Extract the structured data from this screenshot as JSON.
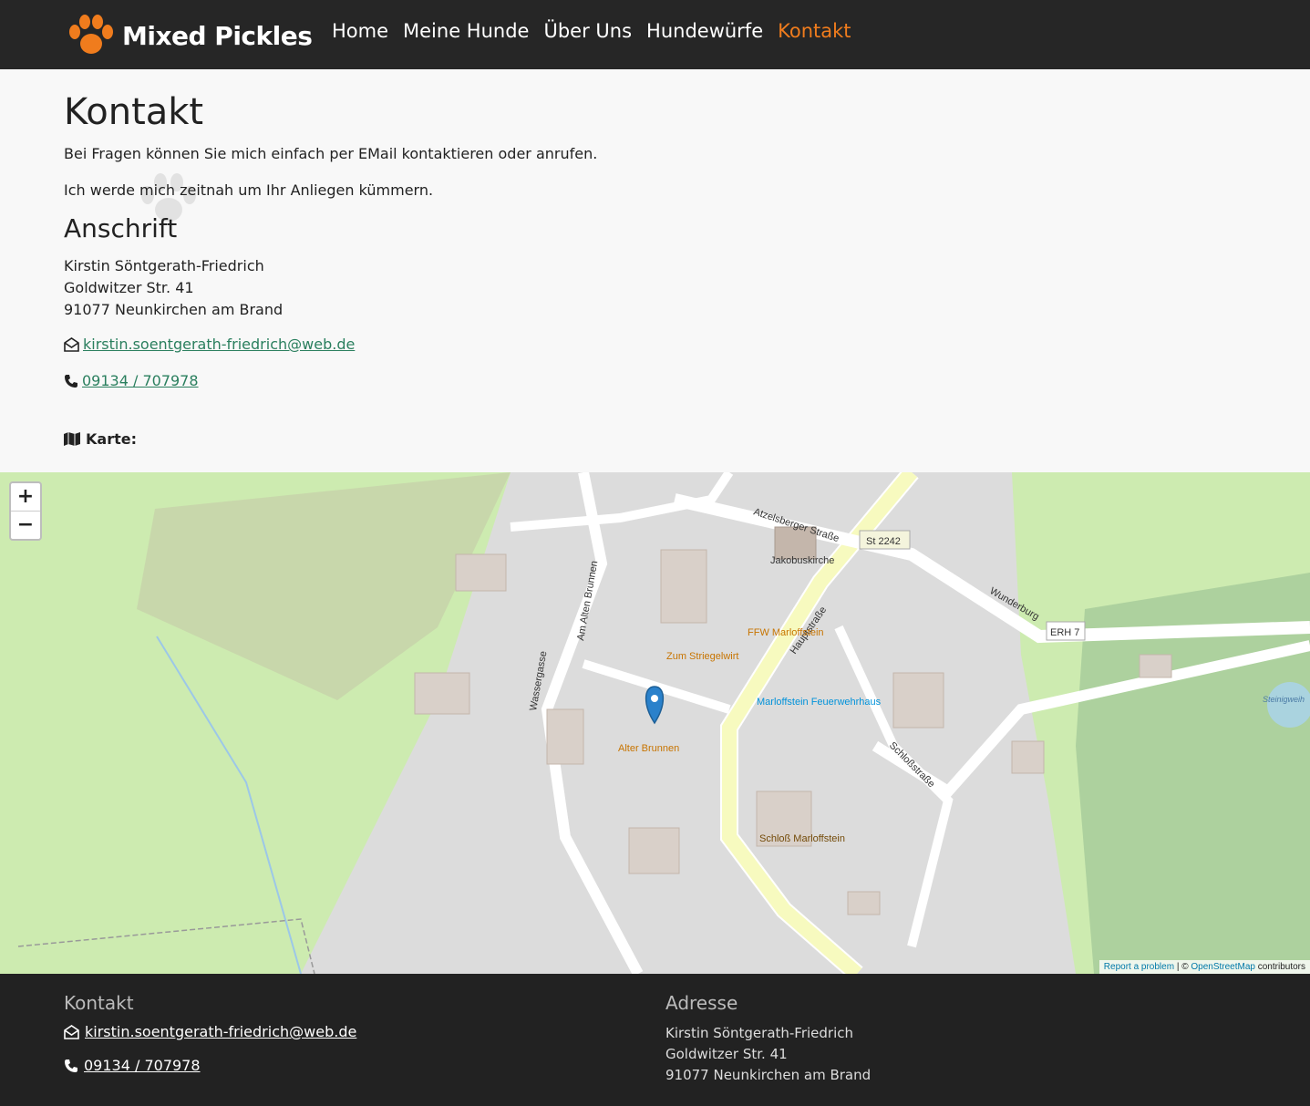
{
  "header": {
    "brand": "Mixed Pickles",
    "nav": [
      "Home",
      "Meine Hunde",
      "Über Uns",
      "Hundewürfe",
      "Kontakt"
    ],
    "active": "Kontakt"
  },
  "main": {
    "title": "Kontakt",
    "p1": "Bei Fragen können Sie mich einfach per EMail kontaktieren oder anrufen.",
    "p2": "Ich werde mich zeitnah um Ihr Anliegen kümmern.",
    "address_heading": "Anschrift",
    "address": [
      "Kirstin Söntgerath-Friedrich",
      "Goldwitzer Str. 41",
      "91077 Neunkirchen am Brand"
    ],
    "email": "kirstin.soentgerath-friedrich@web.de",
    "phone": "09134 / 707978",
    "map_label": "Karte:"
  },
  "map": {
    "zoom_in": "+",
    "zoom_out": "−",
    "attribution": {
      "report": "Report a problem",
      "sep": " | © ",
      "osm": "OpenStreetMap",
      "rest": " contributors"
    },
    "labels": [
      "Atzelsberger Straße",
      "Jakobuskirche",
      "St 2242",
      "Wunderburg",
      "ERH 7",
      "Hauptstraße",
      "Schloßstraße",
      "Wassergasse",
      "Am Alten Brunnen",
      "Zum Striegelwirt",
      "FFW Marloffstein",
      "Marloffstein Feuerwehrhaus",
      "Alter Brunnen",
      "Schloß Marloffstein",
      "Steinigweih"
    ]
  },
  "footer": {
    "contact_heading": "Kontakt",
    "email": "kirstin.soentgerath-friedrich@web.de",
    "phone": "09134 / 707978",
    "address_heading": "Adresse",
    "address": [
      "Kirstin Söntgerath-Friedrich",
      "Goldwitzer Str. 41",
      "91077 Neunkirchen am Brand"
    ]
  },
  "colors": {
    "accent": "#f07c1d",
    "link": "#2a7f5e",
    "bar": "#262626"
  }
}
